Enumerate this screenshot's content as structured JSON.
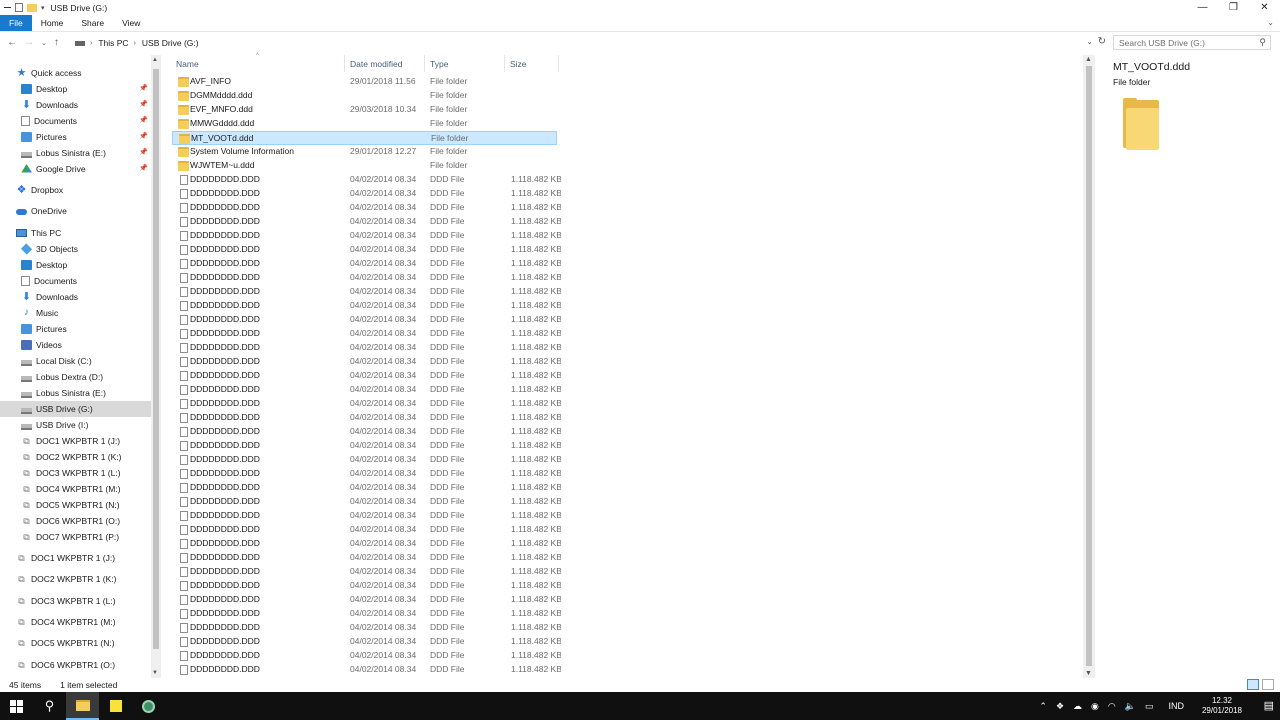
{
  "window": {
    "title": "USB Drive (G:)",
    "minimize": "—",
    "maximize": "❐",
    "close": "✕"
  },
  "ribbon": {
    "tabs": [
      "File",
      "Home",
      "Share",
      "View"
    ]
  },
  "address": {
    "crumbs": [
      "This PC",
      "USB Drive (G:)"
    ],
    "search_placeholder": "Search USB Drive (G:)"
  },
  "nav": {
    "quick_access": "Quick access",
    "quick_items": [
      "Desktop",
      "Downloads",
      "Documents",
      "Pictures",
      "Lobus Sinistra (E:)",
      "Google Drive"
    ],
    "dropbox": "Dropbox",
    "onedrive": "OneDrive",
    "this_pc": "This PC",
    "pc_items": [
      "3D Objects",
      "Desktop",
      "Documents",
      "Downloads",
      "Music",
      "Pictures",
      "Videos",
      "Local Disk (C:)",
      "Lobus Dextra (D:)",
      "Lobus Sinistra (E:)",
      "USB Drive (G:)",
      "USB Drive (I:)",
      "DOC1 WKPBTR 1 (J:)",
      "DOC2 WKPBTR 1 (K:)",
      "DOC3 WKPBTR 1 (L:)",
      "DOC4 WKPBTR1 (M:)",
      "DOC5 WKPBTR1 (N:)",
      "DOC6 WKPBTR1 (O:)",
      "DOC7 WKPBTR1 (P:)"
    ],
    "network_items": [
      "DOC1 WKPBTR 1 (J:)",
      "DOC2 WKPBTR 1 (K:)",
      "DOC3 WKPBTR 1 (L:)",
      "DOC4 WKPBTR1 (M:)",
      "DOC5 WKPBTR1 (N:)",
      "DOC6 WKPBTR1 (O:)"
    ]
  },
  "columns": {
    "name": "Name",
    "date": "Date modified",
    "type": "Type",
    "size": "Size"
  },
  "folders": [
    {
      "name": "AVF_INFO",
      "date": "29/01/2018 11.56",
      "type": "File folder"
    },
    {
      "name": "DGMMdddd.ddd",
      "date": "",
      "type": "File folder"
    },
    {
      "name": "EVF_MNFO.ddd",
      "date": "29/03/2018 10.34",
      "type": "File folder"
    },
    {
      "name": "MMWGdddd.ddd",
      "date": "",
      "type": "File folder"
    },
    {
      "name": "MT_VOOTd.ddd",
      "date": "",
      "type": "File folder"
    },
    {
      "name": "System Volume Information",
      "date": "29/01/2018 12.27",
      "type": "File folder"
    },
    {
      "name": "WJWTEM~u.ddd",
      "date": "",
      "type": "File folder"
    }
  ],
  "file_template": {
    "name": "DDDDDDDD.DDD",
    "date": "04/02/2014 08.34",
    "type": "DDD File",
    "size": "1.118.482 KB"
  },
  "file_count_visible": 36,
  "selected_folder_index": 4,
  "preview": {
    "name": "MT_VOOTd.ddd",
    "type": "File folder"
  },
  "status": {
    "items": "45 items",
    "selected": "1 item selected"
  },
  "taskbar": {
    "language": "IND",
    "time": "12.32",
    "date": "29/01/2018"
  },
  "colors": {
    "accent": "#1979ca",
    "selection": "#cce8ff",
    "folder": "#f5cd5a"
  }
}
